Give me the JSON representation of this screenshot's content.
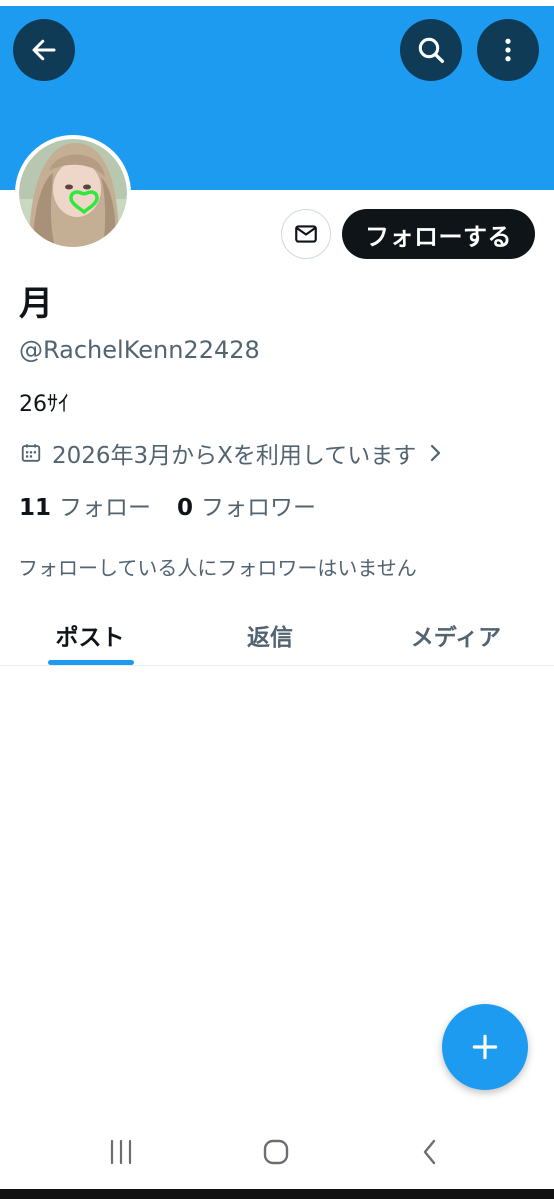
{
  "colors": {
    "banner": "#1d9bf0",
    "primary_text": "#0f1419",
    "secondary_text": "#536471",
    "accent": "#1d9bf0",
    "header_button_bg": "#0f3b57"
  },
  "header": {
    "back_icon": "arrow-left-icon",
    "search_icon": "search-icon",
    "more_icon": "more-vertical-icon"
  },
  "profile": {
    "display_name": "月",
    "handle": "@RachelKenn22428",
    "bio": "26ｻｲ",
    "joined": "2026年3月からXを利用しています",
    "following_count": "11",
    "following_label": "フォロー",
    "followers_count": "0",
    "followers_label": "フォロワー",
    "no_mutual_followers": "フォローしている人にフォロワーはいません"
  },
  "actions": {
    "message_icon": "mail-icon",
    "follow_label": "フォローする"
  },
  "tabs": [
    {
      "label": "ポスト",
      "selected": true
    },
    {
      "label": "返信",
      "selected": false
    },
    {
      "label": "メディア",
      "selected": false
    }
  ],
  "fab": {
    "icon": "plus-icon"
  },
  "system_nav": {
    "recent_icon": "recent-apps-icon",
    "home_icon": "home-circle-icon",
    "back_icon": "nav-back-icon"
  }
}
